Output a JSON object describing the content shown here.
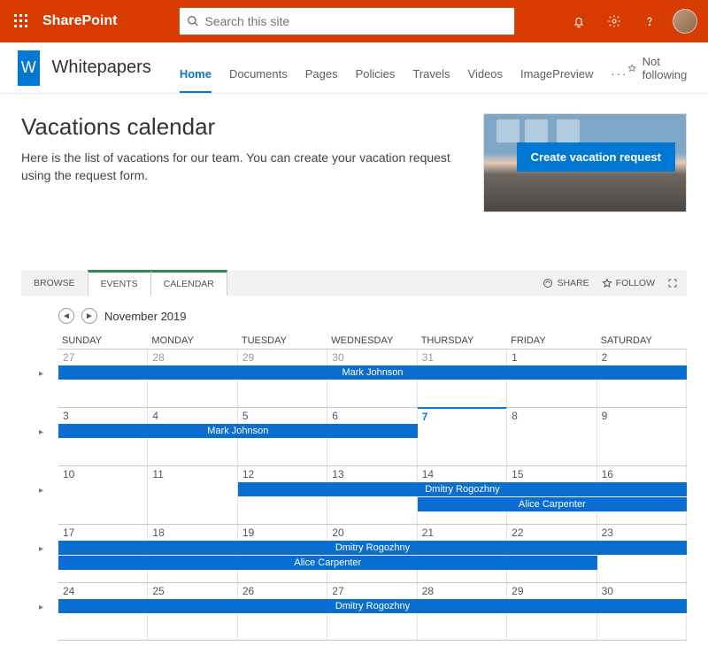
{
  "suite": {
    "brand": "SharePoint",
    "search_placeholder": "Search this site"
  },
  "site": {
    "logo_letter": "W",
    "name": "Whitepapers",
    "follow_label": "Not following",
    "nav": [
      "Home",
      "Documents",
      "Pages",
      "Policies",
      "Travels",
      "Videos",
      "ImagePreview"
    ]
  },
  "page": {
    "title": "Vacations calendar",
    "description": "Here is the list of vacations for our team. You can create your vacation request using the request form.",
    "cta": "Create vacation request"
  },
  "ribbon": {
    "tabs": [
      "BROWSE",
      "EVENTS",
      "CALENDAR"
    ],
    "share": "SHARE",
    "follow": "FOLLOW"
  },
  "calendar": {
    "month_label": "November 2019",
    "day_headers": [
      "SUNDAY",
      "MONDAY",
      "TUESDAY",
      "WEDNESDAY",
      "THURSDAY",
      "FRIDAY",
      "SATURDAY"
    ],
    "weeks": [
      {
        "days": [
          {
            "n": "27",
            "other": true
          },
          {
            "n": "28",
            "other": true
          },
          {
            "n": "29",
            "other": true
          },
          {
            "n": "30",
            "other": true
          },
          {
            "n": "31",
            "other": true
          },
          {
            "n": "1"
          },
          {
            "n": "2"
          }
        ],
        "events": [
          {
            "label": "Mark Johnson",
            "start": 0,
            "end": 7,
            "row": 0
          }
        ]
      },
      {
        "days": [
          {
            "n": "3"
          },
          {
            "n": "4"
          },
          {
            "n": "5"
          },
          {
            "n": "6"
          },
          {
            "n": "7",
            "today": true
          },
          {
            "n": "8"
          },
          {
            "n": "9"
          }
        ],
        "events": [
          {
            "label": "Mark Johnson",
            "start": 0,
            "end": 4,
            "row": 0
          }
        ]
      },
      {
        "days": [
          {
            "n": "10"
          },
          {
            "n": "11"
          },
          {
            "n": "12"
          },
          {
            "n": "13"
          },
          {
            "n": "14"
          },
          {
            "n": "15"
          },
          {
            "n": "16"
          }
        ],
        "events": [
          {
            "label": "Dmitry Rogozhny",
            "start": 2,
            "end": 7,
            "row": 0
          },
          {
            "label": "Alice Carpenter",
            "start": 4,
            "end": 7,
            "row": 1
          }
        ]
      },
      {
        "days": [
          {
            "n": "17"
          },
          {
            "n": "18"
          },
          {
            "n": "19"
          },
          {
            "n": "20"
          },
          {
            "n": "21"
          },
          {
            "n": "22"
          },
          {
            "n": "23"
          }
        ],
        "events": [
          {
            "label": "Dmitry Rogozhny",
            "start": 0,
            "end": 7,
            "row": 0
          },
          {
            "label": "Alice Carpenter",
            "start": 0,
            "end": 6,
            "row": 1
          }
        ]
      },
      {
        "days": [
          {
            "n": "24"
          },
          {
            "n": "25"
          },
          {
            "n": "26"
          },
          {
            "n": "27"
          },
          {
            "n": "28"
          },
          {
            "n": "29"
          },
          {
            "n": "30"
          }
        ],
        "events": [
          {
            "label": "Dmitry Rogozhny",
            "start": 0,
            "end": 7,
            "row": 0
          }
        ]
      }
    ]
  }
}
